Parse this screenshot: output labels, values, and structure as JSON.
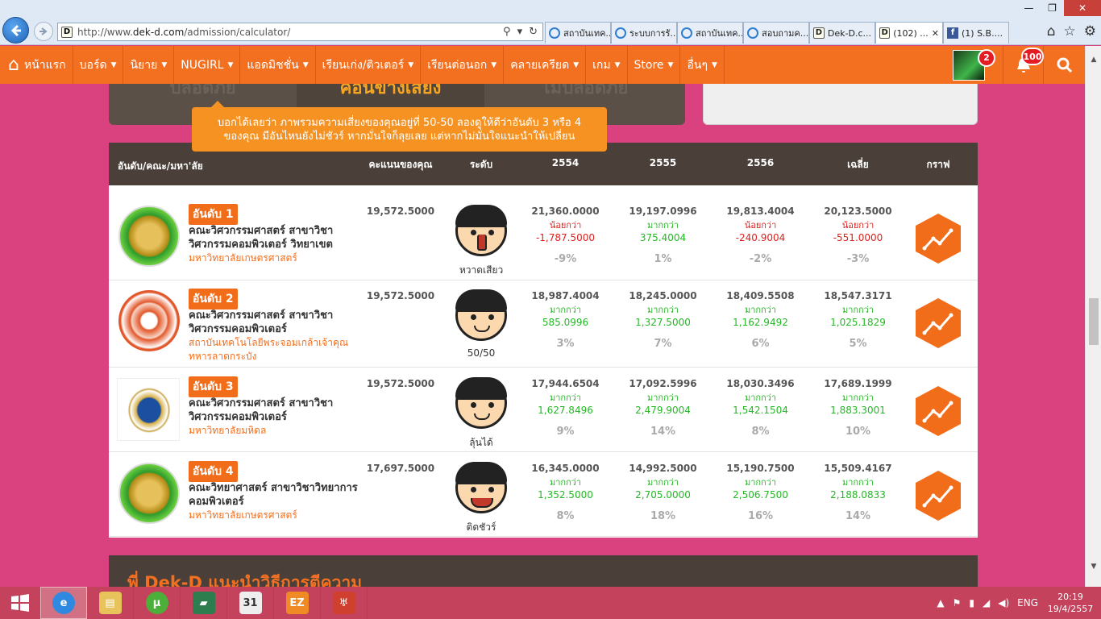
{
  "browser": {
    "url_prefix": "http://www.",
    "url_domain": "dek-d.com",
    "url_path": "/admission/calculator/",
    "tabs": [
      {
        "title": "สถาบันเทค...",
        "icon": "ie-icon"
      },
      {
        "title": "ระบบการรั...",
        "icon": "ie-icon"
      },
      {
        "title": "สถาบันเทค...",
        "icon": "ie-icon"
      },
      {
        "title": "สอบถามค...",
        "icon": "ie-icon"
      },
      {
        "title": "Dek-D.c...",
        "icon": "dekd-icon"
      },
      {
        "title": "(102) ...",
        "icon": "dekd-icon",
        "active": true
      },
      {
        "title": "(1) S.B....",
        "icon": "facebook-icon"
      }
    ]
  },
  "nav": {
    "home": "หน้าแรก",
    "items": [
      "บอร์ด",
      "นิยาย",
      "NUGIRL",
      "แอดมิชชั่น",
      "เรียนเก่ง/ติวเตอร์",
      "เรียนต่อนอก",
      "คลายเครียด",
      "เกม",
      "Store",
      "อื่นๆ"
    ],
    "avatar_badge": "2",
    "bell_badge": "100"
  },
  "risk": {
    "left": "ปลอดภัย",
    "middle": "ค่อนข้างเสี่ยง",
    "right": "ไม่ปลอดภัย",
    "tooltip_line1": "บอกได้เลยว่า ภาพรวมความเสี่ยงของคุณอยู่ที่ 50-50 ลองดูให้ดีว่าอันดับ 3 หรือ 4",
    "tooltip_line2": "ของคุณ มีอันไหนยังไม่ชัวร์ หากมั่นใจก็ลุยเลย แต่หากไม่มั่นใจแนะนำให้เปลี่ยน"
  },
  "table": {
    "headers": {
      "rank": "อันดับ/คณะ/มหา'ลัย",
      "score": "คะแนนของคุณ",
      "level": "ระดับ",
      "y2554": "2554",
      "y2555": "2555",
      "y2556": "2556",
      "avg": "เฉลี่ย",
      "graph": "กราฟ"
    },
    "rows": [
      {
        "rank": "อันดับ 1",
        "faculty": "คณะวิศวกรรมศาสตร์ สาขาวิชาวิศวกรรมคอมพิวเตอร์ วิทยาเขต",
        "university": "มหาวิทยาลัยเกษตรศาสตร์",
        "logo": "ku",
        "score": "19,572.5000",
        "level": "หวาดเสียว",
        "face": "scared",
        "years": [
          {
            "value": "21,360.0000",
            "cmp": "น้อยกว่า",
            "diff": "-1,787.5000",
            "pct": "-9%",
            "dir": "less"
          },
          {
            "value": "19,197.0996",
            "cmp": "มากกว่า",
            "diff": "375.4004",
            "pct": "1%",
            "dir": "more"
          },
          {
            "value": "19,813.4004",
            "cmp": "น้อยกว่า",
            "diff": "-240.9004",
            "pct": "-2%",
            "dir": "less"
          },
          {
            "value": "20,123.5000",
            "cmp": "น้อยกว่า",
            "diff": "-551.0000",
            "pct": "-3%",
            "dir": "less"
          }
        ]
      },
      {
        "rank": "อันดับ 2",
        "faculty": "คณะวิศวกรรมศาสตร์ สาขาวิชาวิศวกรรมคอมพิวเตอร์",
        "university": "สถาบันเทคโนโลยีพระจอมเกล้าเจ้าคุณทหารลาดกระบัง",
        "logo": "kmitl",
        "score": "19,572.5000",
        "level": "50/50",
        "face": "neutral",
        "years": [
          {
            "value": "18,987.4004",
            "cmp": "มากกว่า",
            "diff": "585.0996",
            "pct": "3%",
            "dir": "more"
          },
          {
            "value": "18,245.0000",
            "cmp": "มากกว่า",
            "diff": "1,327.5000",
            "pct": "7%",
            "dir": "more"
          },
          {
            "value": "18,409.5508",
            "cmp": "มากกว่า",
            "diff": "1,162.9492",
            "pct": "6%",
            "dir": "more"
          },
          {
            "value": "18,547.3171",
            "cmp": "มากกว่า",
            "diff": "1,025.1829",
            "pct": "5%",
            "dir": "more"
          }
        ]
      },
      {
        "rank": "อันดับ 3",
        "faculty": "คณะวิศวกรรมศาสตร์ สาขาวิชาวิศวกรรมคอมพิวเตอร์",
        "university": "มหาวิทยาลัยมหิดล",
        "logo": "mu",
        "score": "19,572.5000",
        "level": "ลุ้นได้",
        "face": "neutral",
        "years": [
          {
            "value": "17,944.6504",
            "cmp": "มากกว่า",
            "diff": "1,627.8496",
            "pct": "9%",
            "dir": "more"
          },
          {
            "value": "17,092.5996",
            "cmp": "มากกว่า",
            "diff": "2,479.9004",
            "pct": "14%",
            "dir": "more"
          },
          {
            "value": "18,030.3496",
            "cmp": "มากกว่า",
            "diff": "1,542.1504",
            "pct": "8%",
            "dir": "more"
          },
          {
            "value": "17,689.1999",
            "cmp": "มากกว่า",
            "diff": "1,883.3001",
            "pct": "10%",
            "dir": "more"
          }
        ]
      },
      {
        "rank": "อันดับ 4",
        "faculty": "คณะวิทยาศาสตร์ สาขาวิชาวิทยาการคอมพิวเตอร์",
        "university": "มหาวิทยาลัยเกษตรศาสตร์",
        "logo": "ku",
        "score": "17,697.5000",
        "level": "ติดชัวร์",
        "face": "happy",
        "years": [
          {
            "value": "16,345.0000",
            "cmp": "มากกว่า",
            "diff": "1,352.5000",
            "pct": "8%",
            "dir": "more"
          },
          {
            "value": "14,992.5000",
            "cmp": "มากกว่า",
            "diff": "2,705.0000",
            "pct": "18%",
            "dir": "more"
          },
          {
            "value": "15,190.7500",
            "cmp": "มากกว่า",
            "diff": "2,506.7500",
            "pct": "16%",
            "dir": "more"
          },
          {
            "value": "15,509.4167",
            "cmp": "มากกว่า",
            "diff": "2,188.0833",
            "pct": "14%",
            "dir": "more"
          }
        ]
      }
    ]
  },
  "advice_title": "พี่ Dek-D แนะนำวิธีการตีความ",
  "taskbar": {
    "lang": "ENG",
    "time": "20:19",
    "date": "19/4/2557",
    "calendar_icon_text": "31",
    "apps": [
      "ie-icon",
      "file-explorer-icon",
      "utorrent-icon",
      "book-icon",
      "calendar-icon",
      "ez-icon",
      "app-icon"
    ]
  },
  "colors": {
    "orange": "#f37021",
    "dark_brown": "#4a4039",
    "less": "#e0201c",
    "more": "#25b825",
    "page_bg": "#d9417f"
  }
}
